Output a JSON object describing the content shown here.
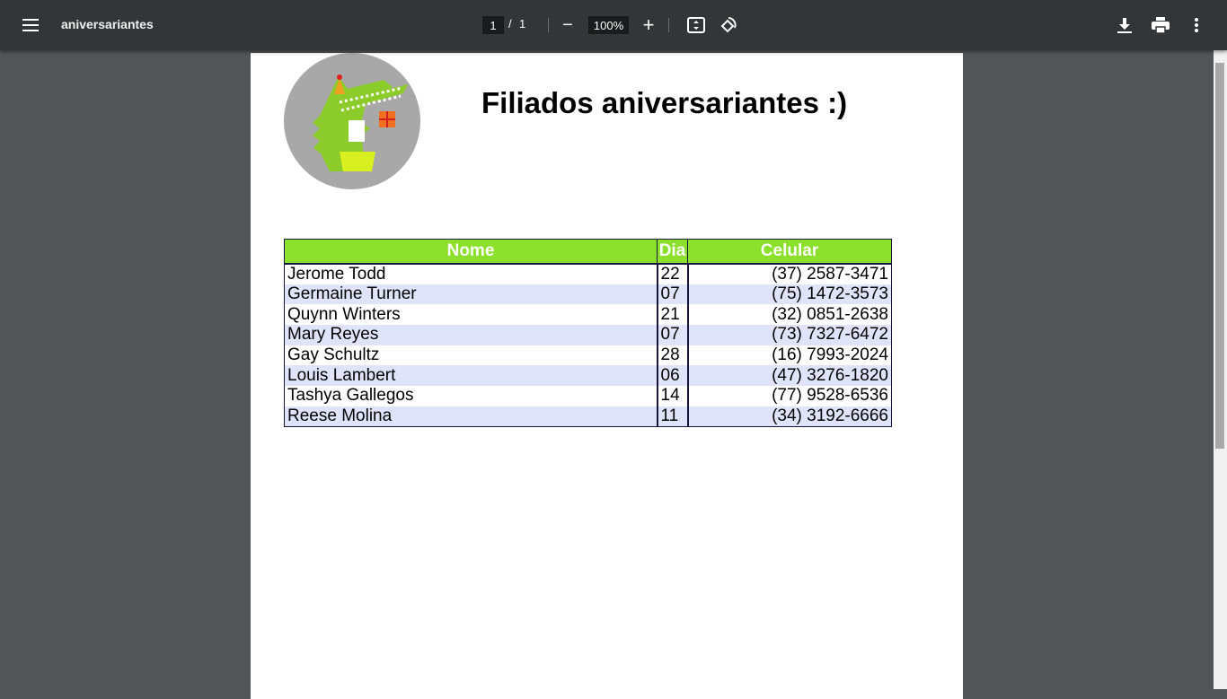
{
  "toolbar": {
    "title": "aniversariantes",
    "page_current": "1",
    "page_sep": "/",
    "page_total": "1",
    "zoom": "100%",
    "minus": "−",
    "plus": "+"
  },
  "document": {
    "title": "Filiados aniversariantes :)",
    "logo": "birthday crocodile"
  },
  "table": {
    "headers": [
      "Nome",
      "Dia",
      "Celular"
    ],
    "header_color": "#8ae02a",
    "stripe_color": "#e0e4fb",
    "rows": [
      [
        "Jerome Todd",
        "22",
        "(37) 2587-3471"
      ],
      [
        "Germaine Turner",
        "07",
        "(75) 1472-3573"
      ],
      [
        "Quynn Winters",
        "21",
        "(32) 0851-2638"
      ],
      [
        "Mary Reyes",
        "07",
        "(73) 7327-6472"
      ],
      [
        "Gay Schultz",
        "28",
        "(16) 7993-2024"
      ],
      [
        "Louis Lambert",
        "06",
        "(47) 3276-1820"
      ],
      [
        "Tashya Gallegos",
        "14",
        "(77) 9528-6536"
      ],
      [
        "Reese Molina",
        "11",
        "(34) 3192-6666"
      ]
    ]
  }
}
